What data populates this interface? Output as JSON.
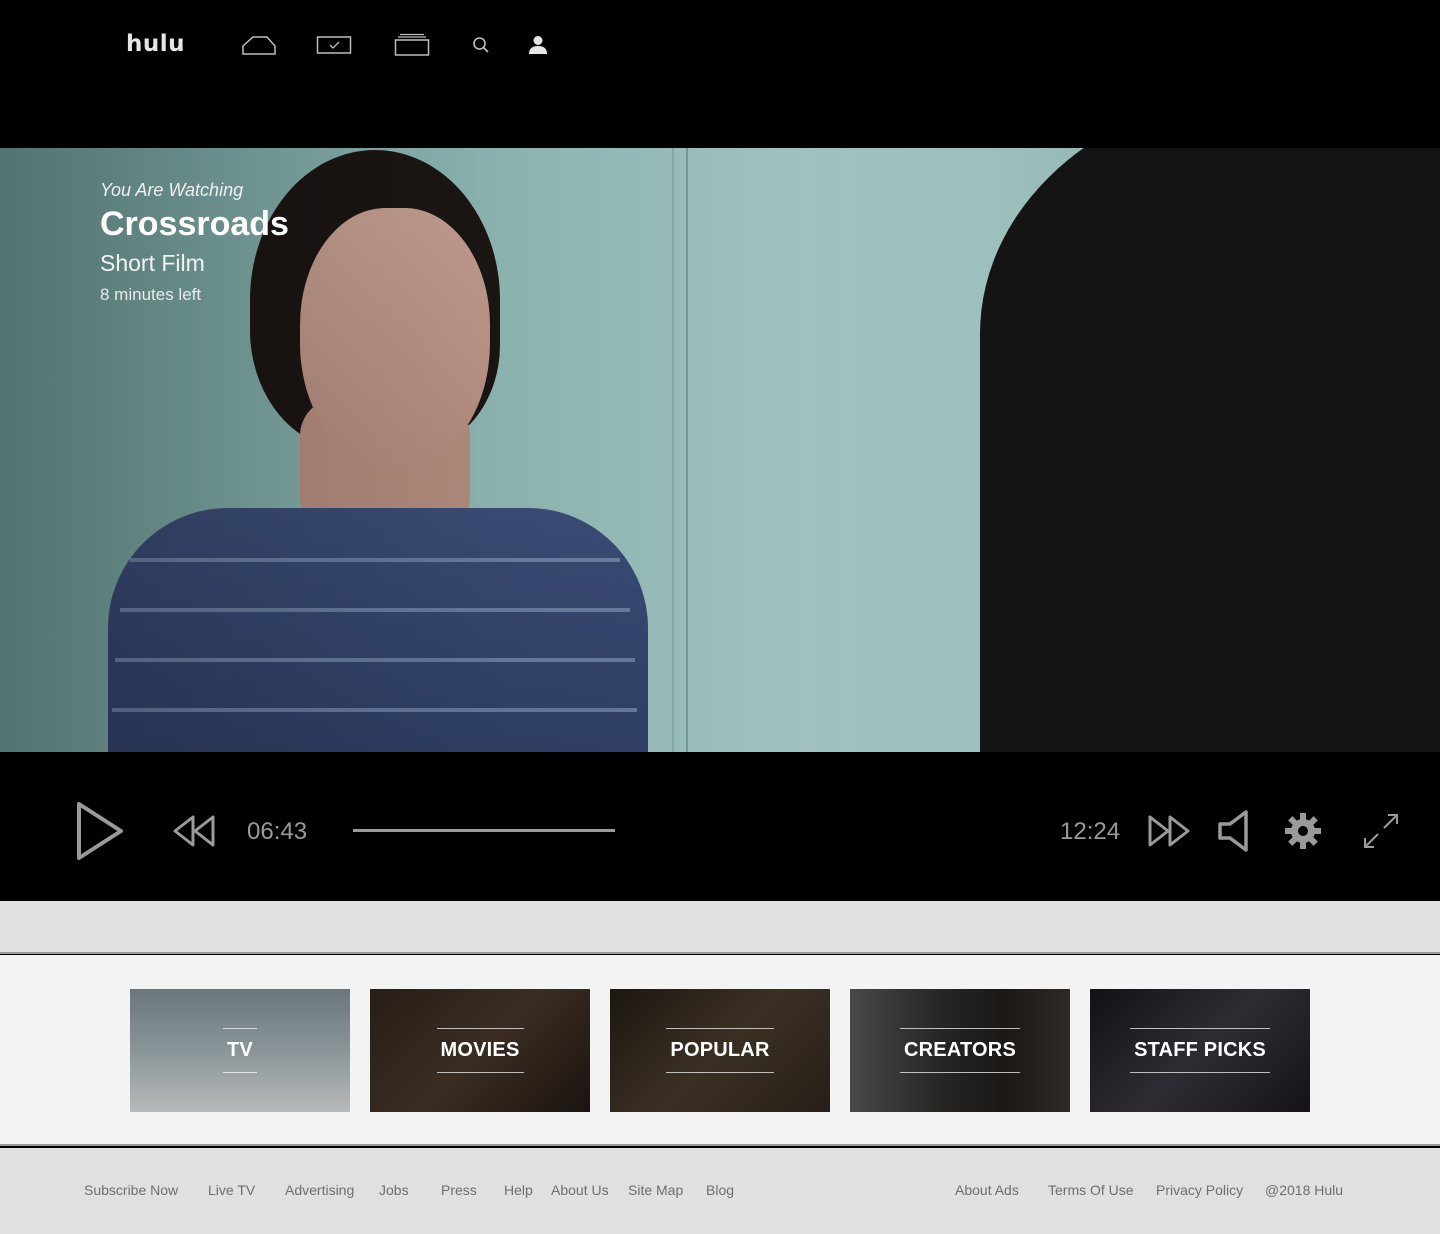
{
  "app": {
    "logo": "hulu"
  },
  "nav": {
    "icons": [
      "home-icon",
      "tv-guide-icon",
      "library-icon",
      "search-icon",
      "profile-icon"
    ]
  },
  "now_playing": {
    "eyebrow": "You Are Watching",
    "title": "Crossroads",
    "subtitle": "Short Film",
    "remaining": "8 minutes left"
  },
  "player": {
    "elapsed": "06:43",
    "duration": "12:24",
    "progress_fraction": 1.0,
    "icons": [
      "play-icon",
      "rewind-icon",
      "fast-forward-icon",
      "volume-icon",
      "settings-icon",
      "fullscreen-icon"
    ]
  },
  "categories": [
    {
      "label": "TV"
    },
    {
      "label": "MOVIES"
    },
    {
      "label": "POPULAR"
    },
    {
      "label": "CREATORS"
    },
    {
      "label": "STAFF PICKS"
    }
  ],
  "footer": {
    "left_links": [
      "Subscribe Now",
      "Live TV",
      "Advertising",
      "Jobs",
      "Press",
      "Help",
      "About Us",
      "Site Map",
      "Blog"
    ],
    "right_links": [
      "About Ads",
      "Terms Of Use",
      "Privacy Policy"
    ],
    "copyright": "@2018 Hulu"
  },
  "colors": {
    "background": "#000000",
    "control_gray": "#9a9a9a",
    "band_gray": "#e0e0e0",
    "categories_bg": "#f3f3f3"
  }
}
